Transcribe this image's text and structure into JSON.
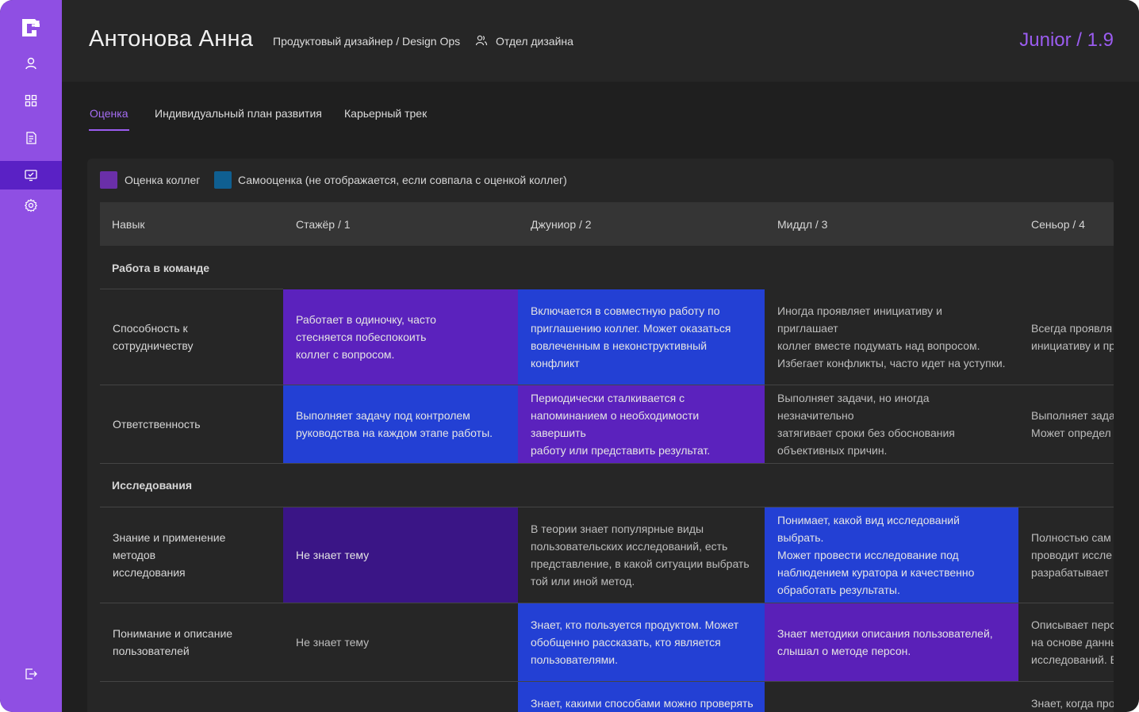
{
  "header": {
    "name": "Антонова Анна",
    "role": "Продуктовый дизайнер / Design Ops",
    "department": "Отдел дизайна",
    "level": "Junior / 1.9"
  },
  "tabs": [
    {
      "label": "Оценка",
      "active": true
    },
    {
      "label": "Индивидуальный план развития",
      "active": false
    },
    {
      "label": "Карьерный трек",
      "active": false
    }
  ],
  "legend": {
    "peer_label": "Оценка коллег",
    "self_label": "Самооценка (не отображается, если совпала с оценкой коллег)",
    "peer_color": "#6a2fa8",
    "self_color": "#0f5f91"
  },
  "table": {
    "columns": [
      "Навык",
      "Стажёр / 1",
      "Джуниор / 2",
      "Миддл / 3",
      "Сеньор / 4"
    ],
    "sections": [
      {
        "title": "Работа в команде",
        "rows": [
          {
            "skill": "Способность к сотрудничеству",
            "cells": [
              "Работает в одиночку, часто\nстесняется побеспокоить\nколлег с вопросом.",
              "Включается в совместную работу по\nприглашению коллег. Может оказаться\nвовлеченным в неконструктивный\nконфликт",
              "Иногда проявляет инициативу и приглашает\nколлег вместе подумать над вопросом.\nИзбегает конфликты, часто идет на уступки.",
              "Всегда проявля\nинициативу и пр"
            ]
          },
          {
            "skill": "Ответственность",
            "cells": [
              "Выполняет задачу под контролем\nруководства на каждом этапе работы.",
              "Периодически сталкивается с\nнапоминанием о необходимости завершить\n работу или представить  результат.",
              "Выполняет задачи, но иногда незначительно\nзатягивает сроки без обоснования\nобъективных причин.",
              "Выполняет зада\nМожет определ"
            ]
          }
        ]
      },
      {
        "title": "Исследования",
        "rows": [
          {
            "skill": "Знание и применение методов\nисследования",
            "cells": [
              "Не знает тему",
              "В теории знает популярные виды\nпользовательских исследований, есть\nпредставление, в какой ситуации выбрать\nтой или иной метод.",
              "Понимает, какой вид исследований выбрать.\n Может провести исследование под\nнаблюдением куратора и качественно\nобработать результаты.",
              "Полностью сам\nпроводит иссле\nразрабатывает"
            ]
          },
          {
            "skill": "Понимание и описание\nпользователей",
            "cells": [
              "Не знает тему",
              "Знает, кто пользуется продуктом. Может\nобобщенно рассказать, кто является\nпользователями.",
              "Знает методики описания пользователей,\nслышал о методе персон.",
              "Описывает перс\nна основе данны\nисследований. В"
            ]
          },
          {
            "skill": "",
            "cells": [
              "",
              "Знает, какими способами можно проверять",
              "",
              "Знает, когда про"
            ]
          }
        ]
      }
    ]
  },
  "colors": {
    "sidebar": "#8f4fe3",
    "sidebar_active": "#5a21c5",
    "accent": "#9b5cf0",
    "cell_purple": "#5b22bd",
    "cell_blue": "#2340d4",
    "cell_dark_purple": "#3a1586"
  },
  "icons": {
    "sidebar": [
      "logo-icon",
      "user-icon",
      "dashboard-icon",
      "document-icon",
      "monitor-check-icon",
      "settings-icon",
      "logout-icon"
    ]
  }
}
